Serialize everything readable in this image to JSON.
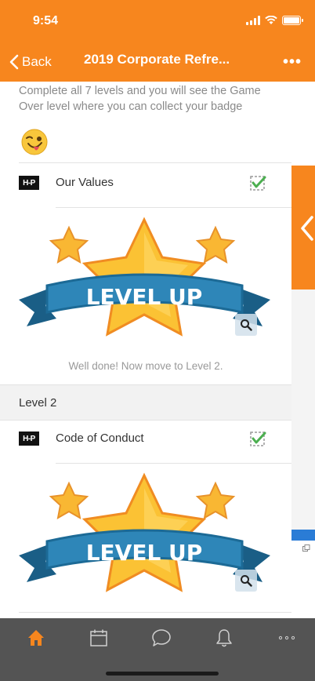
{
  "status_bar": {
    "time": "9:54"
  },
  "nav": {
    "back_label": "Back",
    "title": "2019 Corporate Refre...",
    "more_label": "•••"
  },
  "intro": {
    "text": "Complete all 7 levels and you will see the Game Over level where you can collect your badge",
    "emoji_icon": "winking-tongue-emoji-icon"
  },
  "activities": [
    {
      "logo": "H-P",
      "label": "Our Values",
      "completed": true,
      "banner_text": "LEVEL UP",
      "caption": "Well done! Now move to Level 2."
    },
    {
      "logo": "H-P",
      "label": "Code of Conduct",
      "completed": true,
      "banner_text": "LEVEL UP"
    }
  ],
  "level_header": {
    "label": "Level 2"
  },
  "tab_bar": {
    "items": [
      {
        "icon": "home-icon",
        "active": true
      },
      {
        "icon": "calendar-icon",
        "active": false
      },
      {
        "icon": "chat-icon",
        "active": false
      },
      {
        "icon": "bell-icon",
        "active": false
      },
      {
        "icon": "more-icon",
        "active": false
      }
    ]
  },
  "colors": {
    "accent": "#f7861e",
    "tab_bar": "#545454",
    "tab_active": "#f7861e",
    "tab_inactive": "#d0d0d0"
  }
}
